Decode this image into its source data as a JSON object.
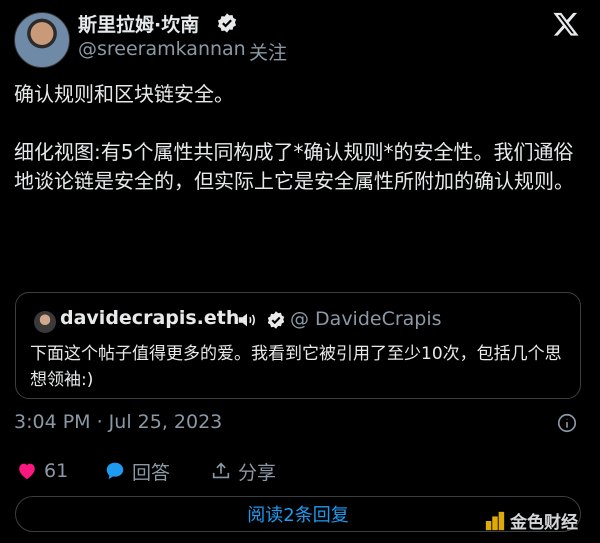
{
  "author": {
    "display_name": "斯里拉姆·坎南",
    "handle": "@sreeramkannan",
    "follow_label": "关注",
    "avatar_icon": "avatar",
    "verified_icon": "verified-badge-icon"
  },
  "brand_icon": "x-logo-icon",
  "tweet": {
    "paragraphs": [
      "确认规则和区块链安全。",
      "细化视图:有5个属性共同构成了*确认规则*的安全性。我们通俗地谈论链是安全的，但实际上它是安全属性所附加的确认规则。"
    ]
  },
  "quote": {
    "display_name": "davidecrapis.eth",
    "handle": "@ DavideCrapis",
    "text": "下面这个帖子值得更多的爱。我看到它被引用了至少10次，包括几个思想领袖:)"
  },
  "meta": {
    "timestamp": "3:04 PM · Jul 25, 2023"
  },
  "actions": {
    "like_count": "61",
    "reply_label": "回答",
    "share_label": "分享"
  },
  "read_replies_label": "阅读2条回复",
  "watermark": {
    "text": "金色财经"
  },
  "colors": {
    "background": "#000000",
    "text": "#e7e9ea",
    "muted": "#8b98a5",
    "accent": "#1d9bf0",
    "like": "#f91880",
    "watermark_logo": "#f0b90b"
  }
}
